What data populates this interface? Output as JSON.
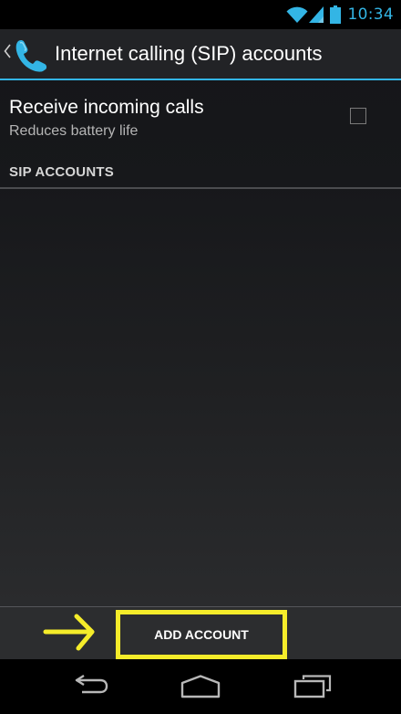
{
  "status_bar": {
    "time": "10:34",
    "icons": [
      "wifi-icon",
      "signal-icon",
      "battery-icon"
    ],
    "accent_color": "#33b5e5"
  },
  "action_bar": {
    "title": "Internet calling (SIP) accounts",
    "up_icon": "chevron-left-icon",
    "app_icon": "phone-handset-icon",
    "accent_color": "#33b5e5"
  },
  "preference": {
    "title": "Receive incoming calls",
    "summary": "Reduces battery life",
    "checked": false
  },
  "category": {
    "header": "SIP ACCOUNTS",
    "accounts": []
  },
  "button_bar": {
    "add_account_label": "ADD ACCOUNT"
  },
  "annotation": {
    "highlight_color": "#f5ec2a",
    "arrow_icon": "arrow-right-icon"
  },
  "nav_bar": {
    "buttons": [
      "back-icon",
      "home-icon",
      "recents-icon"
    ]
  }
}
